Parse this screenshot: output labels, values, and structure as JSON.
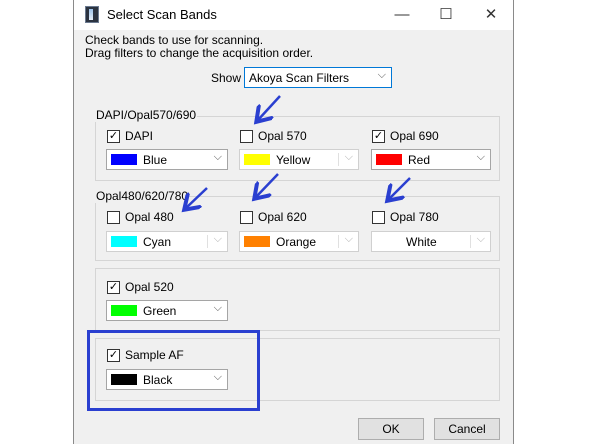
{
  "window": {
    "title": "Select Scan Bands",
    "minimize": "—",
    "maximize": "☐",
    "close": "✕"
  },
  "instructions": {
    "line1": "Check bands to use for scanning.",
    "line2": "Drag filters to change the acquisition order."
  },
  "show": {
    "label": "Show",
    "value": "Akoya Scan Filters"
  },
  "groups": [
    {
      "title": "DAPI/Opal570/690",
      "bands": [
        {
          "name": "DAPI",
          "checked": true,
          "color_name": "Blue",
          "color": "#0000ff"
        },
        {
          "name": "Opal 570",
          "checked": false,
          "color_name": "Yellow",
          "color": "#ffff00"
        },
        {
          "name": "Opal 690",
          "checked": true,
          "color_name": "Red",
          "color": "#ff0000"
        }
      ]
    },
    {
      "title": "Opal480/620/780",
      "bands": [
        {
          "name": "Opal 480",
          "checked": false,
          "color_name": "Cyan",
          "color": "#00ffff"
        },
        {
          "name": "Opal 620",
          "checked": false,
          "color_name": "Orange",
          "color": "#ff8000"
        },
        {
          "name": "Opal 780",
          "checked": false,
          "color_name": "White",
          "color": "#ffffff"
        }
      ]
    },
    {
      "title": "",
      "bands": [
        {
          "name": "Opal 520",
          "checked": true,
          "color_name": "Green",
          "color": "#00ff00"
        }
      ]
    },
    {
      "title": "",
      "bands": [
        {
          "name": "Sample AF",
          "checked": true,
          "color_name": "Black",
          "color": "#000000"
        }
      ]
    }
  ],
  "buttons": {
    "ok": "OK",
    "cancel": "Cancel"
  },
  "annotation_color": "#2a3fd0",
  "icons": {
    "check": "✓",
    "dropdown": "⌵"
  }
}
